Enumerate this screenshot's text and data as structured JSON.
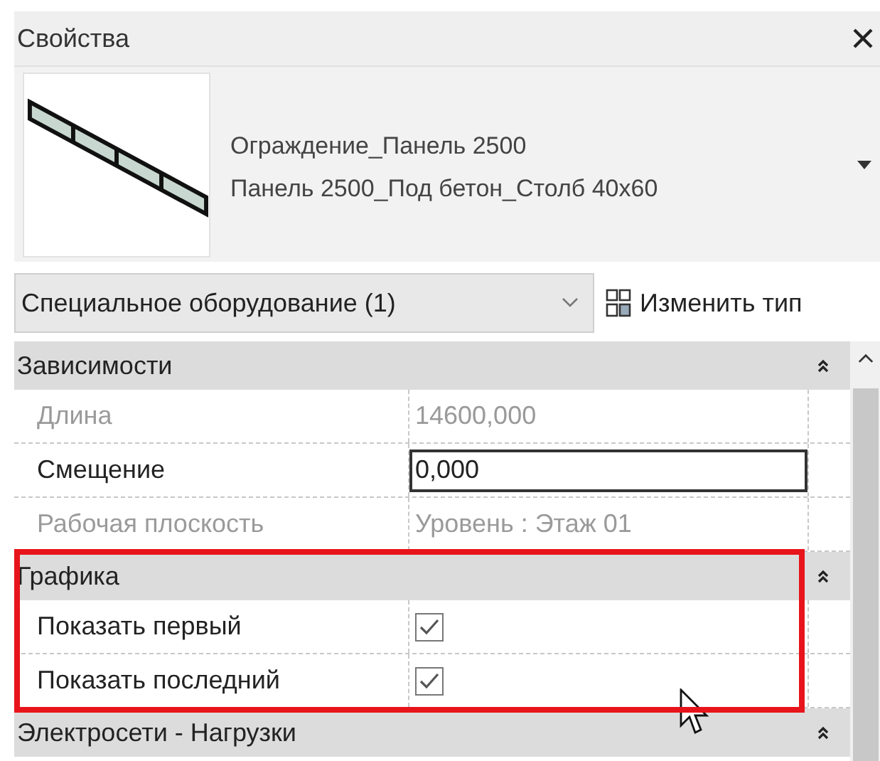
{
  "window": {
    "title": "Свойства"
  },
  "type_selector": {
    "family": "Ограждение_Панель 2500",
    "type": "Панель 2500_Под бетон_Столб 40х60"
  },
  "filter": {
    "value": "Специальное оборудование (1)",
    "edit_type_button": "Изменить тип"
  },
  "groups": [
    {
      "title": "Зависимости",
      "expanded": true,
      "highlighted": false,
      "properties": [
        {
          "name": "Длина",
          "kind": "text",
          "disabled": true,
          "value": "14600,000"
        },
        {
          "name": "Смещение",
          "kind": "input",
          "disabled": false,
          "value": "0,000"
        },
        {
          "name": "Рабочая плоскость",
          "kind": "text",
          "disabled": true,
          "value": "Уровень : Этаж 01"
        }
      ]
    },
    {
      "title": "Графика",
      "expanded": true,
      "highlighted": true,
      "properties": [
        {
          "name": "Показать первый",
          "kind": "checkbox",
          "disabled": false,
          "checked": true
        },
        {
          "name": "Показать последний",
          "kind": "checkbox",
          "disabled": false,
          "checked": true
        }
      ]
    },
    {
      "title": "Электросети - Нагрузки",
      "expanded": true,
      "highlighted": false
    }
  ]
}
